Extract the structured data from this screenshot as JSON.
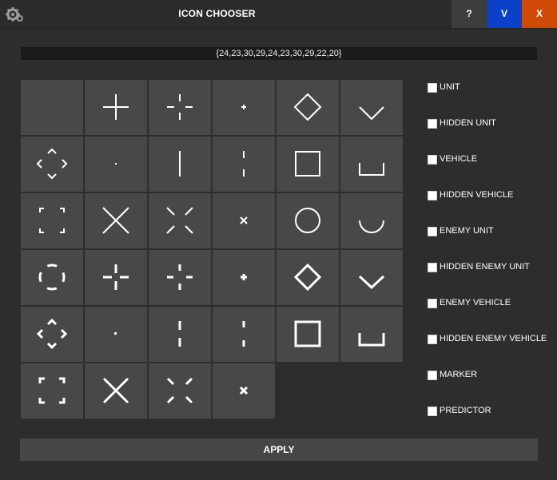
{
  "window": {
    "title": "ICON CHOOSER",
    "buttons": {
      "help": "?",
      "v": "V",
      "close": "X"
    },
    "colors": {
      "background": "#2d2d2d",
      "tile": "#484848",
      "v_button": "#0b40c8",
      "close_button": "#cf4a06"
    }
  },
  "code_value": "{24,23,30,29,24,23,30,29,22,20}",
  "icons": [
    [
      "blank-icon",
      "crosshair-icon",
      "dashed-crosshair-icon",
      "small-plus-icon",
      "diamond-icon",
      "chevron-down-icon"
    ],
    [
      "diamond-corners-icon",
      "dot-icon",
      "vertical-line-icon",
      "dashed-vertical-line-icon",
      "square-icon",
      "bracket-cup-icon"
    ],
    [
      "square-corners-icon",
      "x-cross-icon",
      "dashed-x-cross-icon",
      "small-x-icon",
      "circle-icon",
      "half-circle-icon"
    ],
    [
      "dashed-circle-icon",
      "bold-crosshair-icon",
      "bold-dashed-crosshair-icon",
      "bold-plus-icon",
      "bold-diamond-icon",
      "bold-chevron-down-icon"
    ],
    [
      "bold-diamond-corners-icon",
      "bold-dot-icon",
      "bold-vertical-line-icon",
      "bold-dashed-vertical-line-icon",
      "bold-square-icon",
      "bold-bracket-cup-icon"
    ],
    [
      "bold-square-corners-icon",
      "bold-x-cross-icon",
      "bold-dashed-x-cross-icon",
      "bold-small-x-icon"
    ]
  ],
  "options": [
    {
      "label": "UNIT",
      "checked": false
    },
    {
      "label": "HIDDEN UNIT",
      "checked": false
    },
    {
      "label": "VEHICLE",
      "checked": false
    },
    {
      "label": "HIDDEN VEHICLE",
      "checked": false
    },
    {
      "label": "ENEMY UNIT",
      "checked": false
    },
    {
      "label": "HIDDEN ENEMY UNIT",
      "checked": false
    },
    {
      "label": "ENEMY VEHICLE",
      "checked": false
    },
    {
      "label": "HIDDEN ENEMY VEHICLE",
      "checked": false
    },
    {
      "label": "MARKER",
      "checked": false
    },
    {
      "label": "PREDICTOR",
      "checked": false
    }
  ],
  "apply_label": "APPLY"
}
